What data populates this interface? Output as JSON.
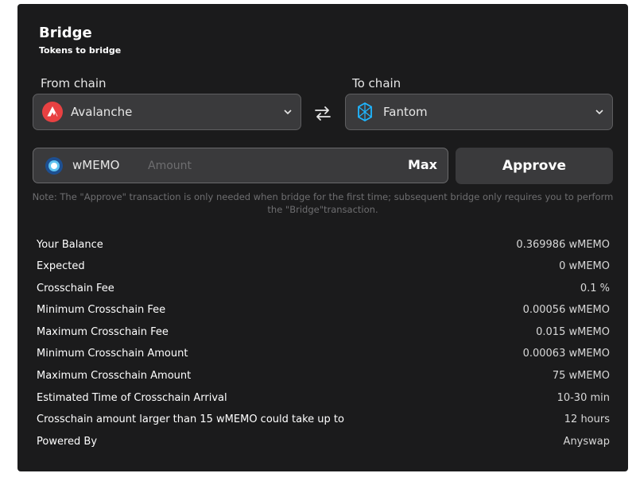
{
  "header": {
    "title": "Bridge",
    "subtitle": "Tokens to bridge"
  },
  "from_chain": {
    "label": "From chain",
    "value": "Avalanche",
    "icon": "avalanche-logo-icon",
    "icon_color": "#e84142"
  },
  "to_chain": {
    "label": "To chain",
    "value": "Fantom",
    "icon": "fantom-logo-icon",
    "icon_color": "#1969ff"
  },
  "amount": {
    "token": "wMEMO",
    "placeholder": "Amount",
    "value": "",
    "max_label": "Max"
  },
  "approve_label": "Approve",
  "note": "Note: The \"Approve\" transaction is only needed when bridge for the first time; subsequent bridge only requires you to perform the \"Bridge\"transaction.",
  "info": [
    {
      "label": "Your Balance",
      "value": "0.369986 wMEMO"
    },
    {
      "label": "Expected",
      "value": "0 wMEMO"
    },
    {
      "label": "Crosschain Fee",
      "value": "0.1 %"
    },
    {
      "label": "Minimum Crosschain Fee",
      "value": "0.00056 wMEMO"
    },
    {
      "label": "Maximum Crosschain Fee",
      "value": "0.015 wMEMO"
    },
    {
      "label": "Minimum Crosschain Amount",
      "value": "0.00063 wMEMO"
    },
    {
      "label": "Maximum Crosschain Amount",
      "value": "75 wMEMO"
    },
    {
      "label": "Estimated Time of Crosschain Arrival",
      "value": "10-30 min"
    },
    {
      "label": "Crosschain amount larger than 15 wMEMO could take up to",
      "value": "12 hours"
    },
    {
      "label": "Powered By",
      "value": "Anyswap"
    }
  ],
  "colors": {
    "card_background": "#1b1b1c",
    "field_background": "#3a3a3c",
    "note_text": "#6e6e70"
  }
}
